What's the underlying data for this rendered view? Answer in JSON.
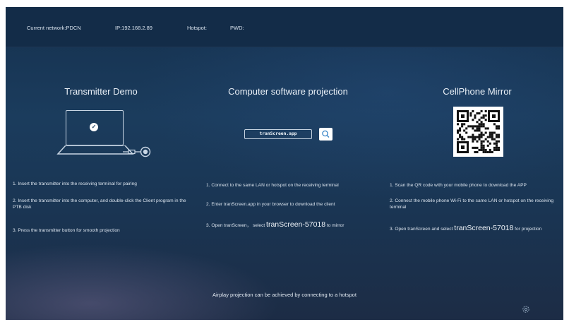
{
  "status_bar": {
    "network": "Current network:PDCN",
    "ip": "IP:192.168.2.89",
    "hotspot": "Hotspot:",
    "pwd": "PWD:"
  },
  "transmitter": {
    "title": "Transmitter Demo",
    "steps": [
      "1. Insert the transmitter into the receiving terminal for pairing",
      "2. Insert the transmitter into the computer, and double-click the Client program in the PTB disk",
      "3. Press the transmitter button for smooth projection"
    ]
  },
  "software": {
    "title": "Computer software projection",
    "url": "tranScreen.app",
    "steps": [
      "1. Connect to the same LAN or hotspot on the receiving terminal",
      "2. Enter tranScreen.app in your browser to download the client"
    ],
    "step3_prefix": "3. Open tranScreen， select ",
    "step3_device": "tranScreen-57018",
    "step3_suffix": " to mirror"
  },
  "cellphone": {
    "title": "CellPhone Mirror",
    "steps": [
      "1. Scan the QR code with your mobile phone to download the APP",
      "2. Connect the mobile phone Wi-Fi to the same LAN or hotspot on the receiving terminal"
    ],
    "step3_prefix": "3. Open tranScreen and select ",
    "step3_device": "tranScreen-57018",
    "step3_suffix": " for projection"
  },
  "footer": {
    "hotspot_note": "Airplay projection can be achieved by connecting to a hotspot"
  },
  "colors": {
    "background": "#1b3c5d",
    "topbar": "#132c48",
    "text": "#dfe8f2",
    "qr_background": "#ffffff"
  },
  "icons": [
    "check-icon",
    "usb-dongle-icon",
    "search-icon",
    "qr-code",
    "settings-icon"
  ]
}
